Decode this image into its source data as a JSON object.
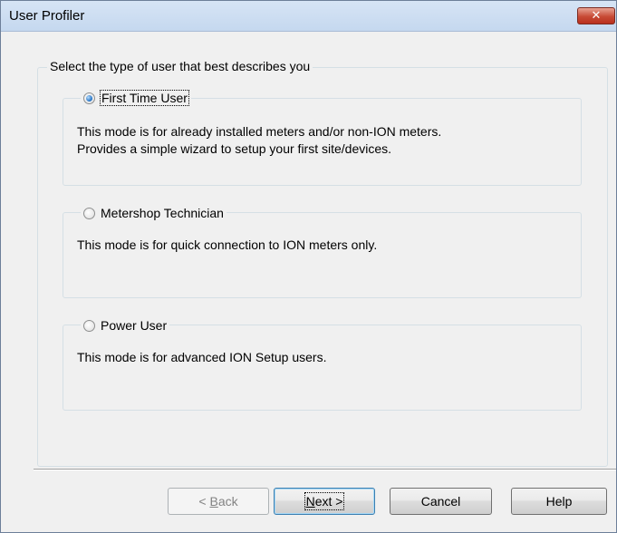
{
  "window": {
    "title": "User Profiler",
    "close_glyph": "✕"
  },
  "group": {
    "label": "Select the type of user that best describes you"
  },
  "options": [
    {
      "label": "First Time User",
      "checked": true,
      "desc_line1": "This mode is for already installed meters and/or non-ION meters.",
      "desc_line2": "Provides a simple wizard to setup your first site/devices."
    },
    {
      "label": "Metershop Technician",
      "checked": false,
      "desc_line1": "This mode is for quick connection to ION meters only."
    },
    {
      "label": "Power User",
      "checked": false,
      "desc_line1": "This mode is for advanced ION Setup users."
    }
  ],
  "buttons": {
    "back_pre": "< ",
    "back_key": "B",
    "back_rest": "ack",
    "back_enabled": false,
    "next_key": "N",
    "next_rest": "ext >",
    "cancel": "Cancel",
    "help": "Help"
  },
  "icons": {
    "close": "close-icon",
    "radio": "radio-icon"
  },
  "colors": {
    "title_bar": "#d6e4f5",
    "close_button": "#c74a35",
    "radio_selected": "#1e6fc4",
    "dialog_bg": "#f0f0f0"
  }
}
